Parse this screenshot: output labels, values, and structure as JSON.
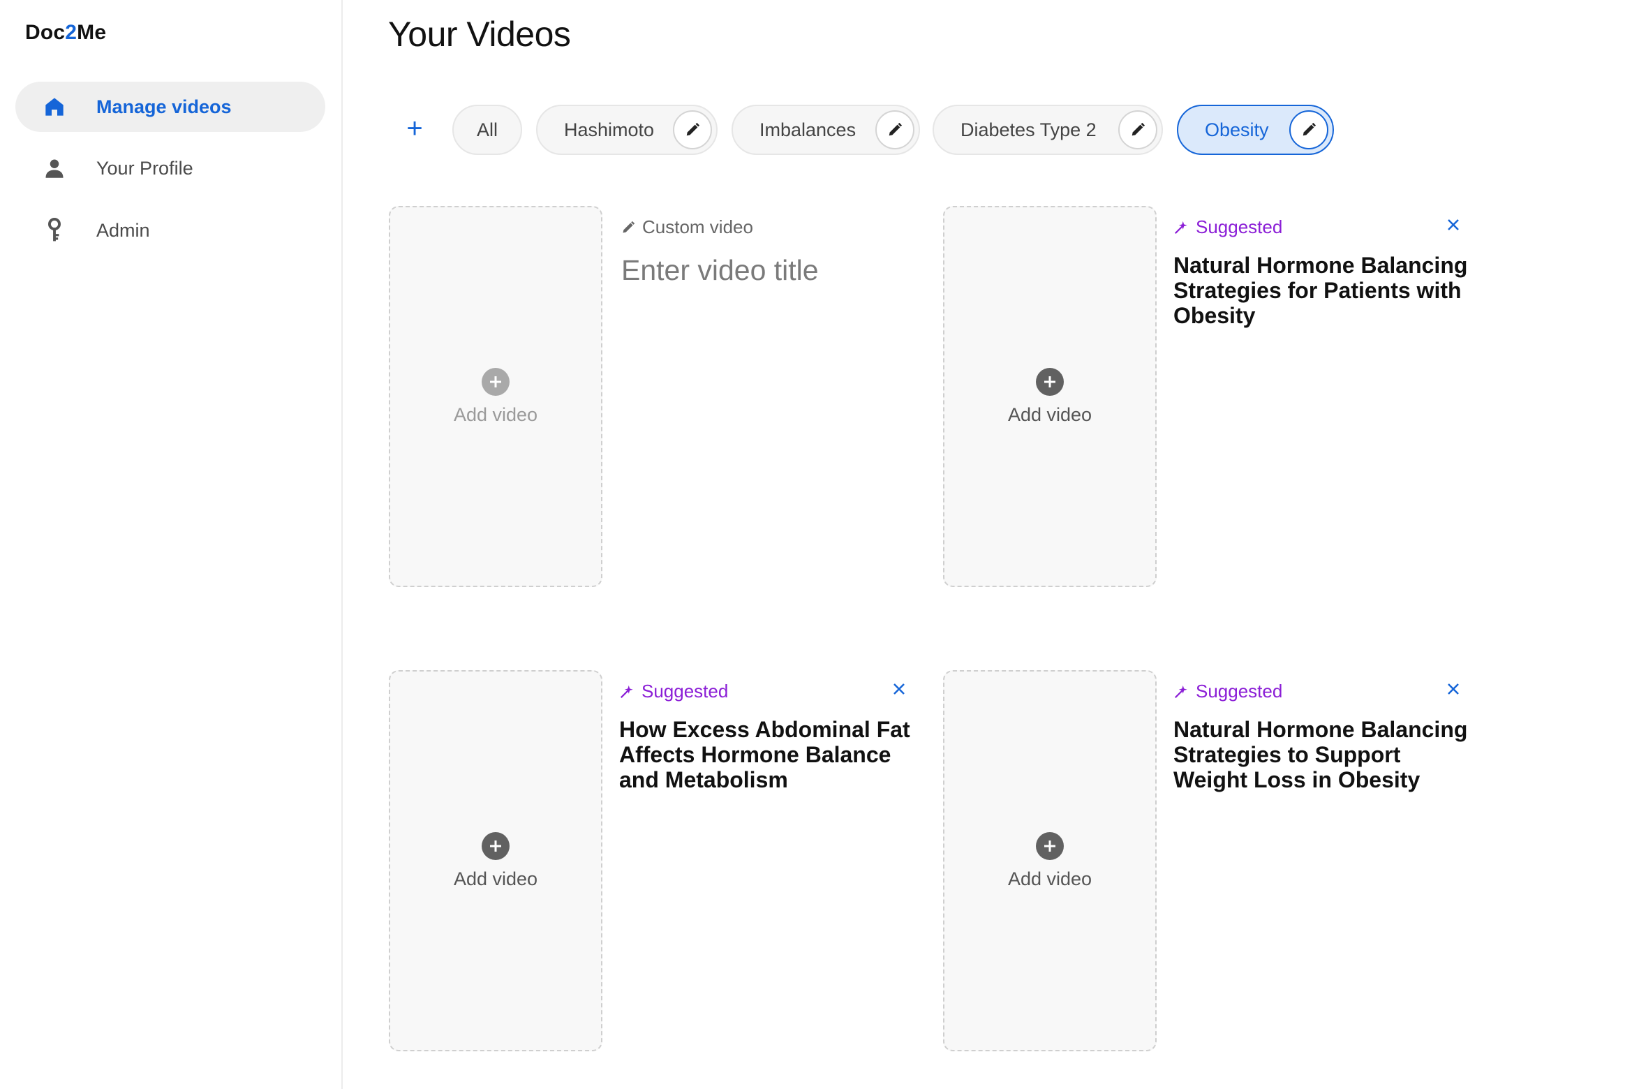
{
  "app": {
    "logo_prefix": "Doc",
    "logo_accent": "2",
    "logo_suffix": "Me"
  },
  "sidebar": {
    "items": [
      {
        "label": "Manage videos",
        "icon": "home-icon",
        "active": true
      },
      {
        "label": "Your Profile",
        "icon": "person-icon",
        "active": false
      },
      {
        "label": "Admin",
        "icon": "key-icon",
        "active": false
      }
    ]
  },
  "main": {
    "title": "Your Videos",
    "add_category_label": "+",
    "categories": [
      {
        "label": "All",
        "editable": false,
        "selected": false
      },
      {
        "label": "Hashimoto",
        "editable": true,
        "selected": false
      },
      {
        "label": "Imbalances",
        "editable": true,
        "selected": false
      },
      {
        "label": "Diabetes Type 2",
        "editable": true,
        "selected": false
      },
      {
        "label": "Obesity",
        "editable": true,
        "selected": true
      }
    ],
    "cards": [
      {
        "type": "custom",
        "tag": "Custom video",
        "title_placeholder": "Enter video title",
        "add_label": "Add video"
      },
      {
        "type": "suggested",
        "tag": "Suggested",
        "title": "Natural Hormone Balancing Strategies for Patients with Obesity",
        "add_label": "Add video"
      },
      {
        "type": "suggested",
        "tag": "Suggested",
        "title": "How Excess Abdominal Fat Affects Hormone Balance and Metabolism",
        "add_label": "Add video"
      },
      {
        "type": "suggested",
        "tag": "Suggested",
        "title": "Natural Hormone Balancing Strategies to Support Weight Loss in Obesity",
        "add_label": "Add video"
      }
    ]
  },
  "colors": {
    "accent": "#1565d8",
    "suggested": "#8b1ed6",
    "selected_chip_bg": "#dbe9fb"
  }
}
